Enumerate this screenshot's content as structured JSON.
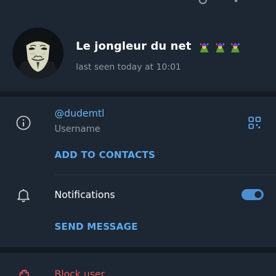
{
  "profile": {
    "name": "Le jongleur du net",
    "status": "last seen today at 10:01",
    "name_emojis": [
      "juggler-emoji",
      "juggler-emoji",
      "juggler-emoji"
    ]
  },
  "info": {
    "username": "@dudemtl",
    "username_label": "Username",
    "add_to_contacts": "ADD TO CONTACTS"
  },
  "notifications": {
    "label": "Notifications",
    "enabled": true,
    "send_message": "SEND MESSAGE"
  },
  "actions": {
    "block_user": "Block user"
  },
  "colors": {
    "background": "#1d2733",
    "separator": "#141b23",
    "accent": "#5eaaf0",
    "toggle": "#4c8fd1",
    "danger": "#e05a5a",
    "muted": "#8e9aa7"
  }
}
